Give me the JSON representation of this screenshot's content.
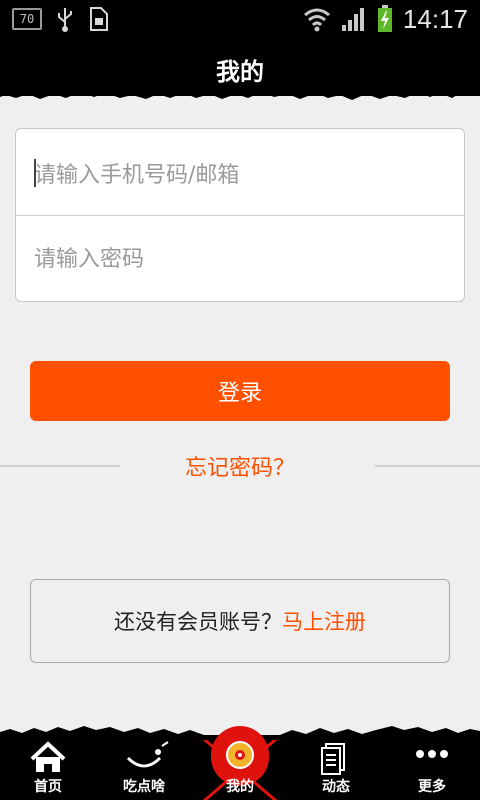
{
  "status_bar": {
    "badge": "70",
    "time": "14:17",
    "icons": [
      "usb-icon",
      "sim-icon",
      "wifi-icon",
      "signal-icon",
      "battery-charging-icon"
    ]
  },
  "header": {
    "title": "我的"
  },
  "form": {
    "account_placeholder": "请输入手机号码/邮箱",
    "password_placeholder": "请输入密码"
  },
  "login_button": "登录",
  "forgot_password": "忘记密码？",
  "register": {
    "prompt": "还没有会员账号？",
    "link": "马上注册"
  },
  "bottom_nav": {
    "items": [
      {
        "label": "首页",
        "icon": "home-icon"
      },
      {
        "label": "吃点啥",
        "icon": "smile-face-icon"
      },
      {
        "label": "我的",
        "icon": "disc-icon",
        "active": true
      },
      {
        "label": "动态",
        "icon": "document-icon"
      },
      {
        "label": "更多",
        "icon": "more-dots-icon"
      }
    ]
  },
  "colors": {
    "accent": "#ff5000",
    "active_tab": "#e0120e",
    "bar": "#000000"
  }
}
